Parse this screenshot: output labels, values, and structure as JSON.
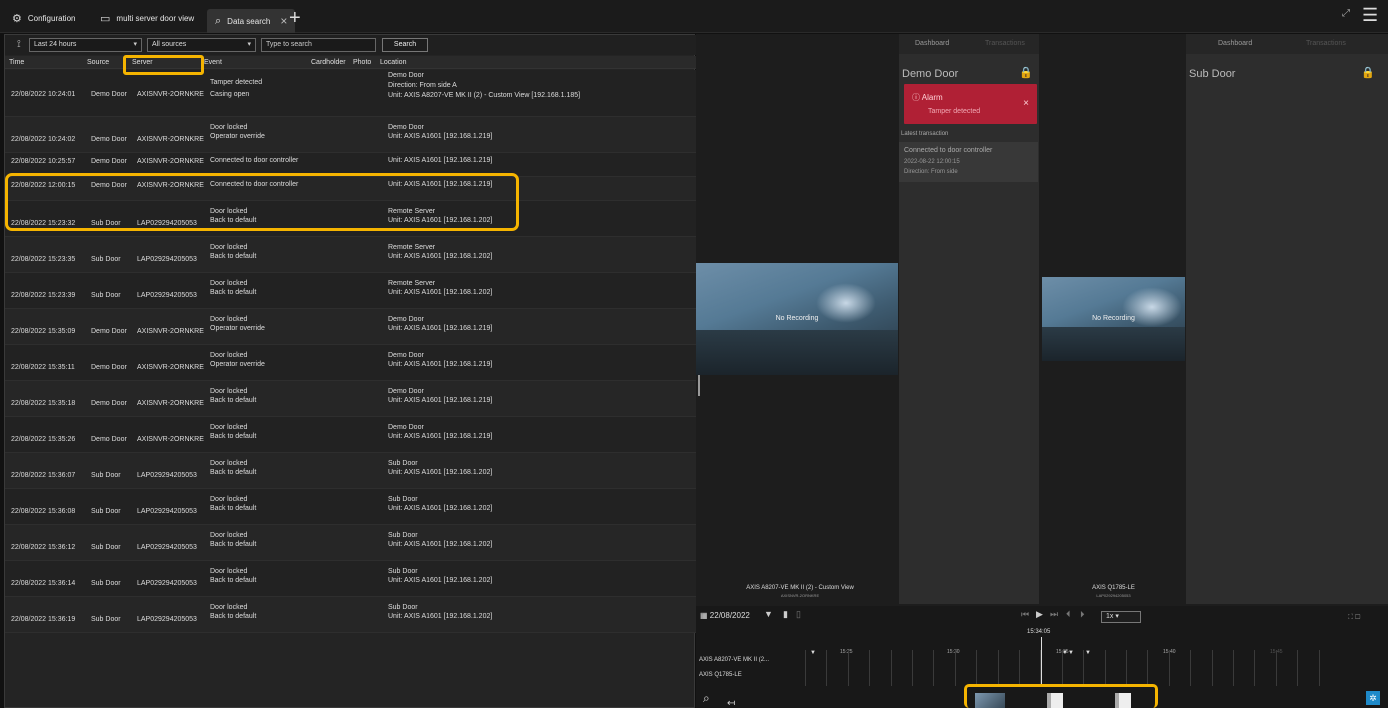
{
  "tabs": [
    {
      "label": "Configuration",
      "icon": "gear-icon"
    },
    {
      "label": "multi server door view",
      "icon": "monitor-icon"
    },
    {
      "label": "Data search",
      "icon": "search-icon"
    }
  ],
  "filters": {
    "time_range": "Last 24 hours",
    "sources": "All sources",
    "search_placeholder": "Type to search",
    "search_button": "Search"
  },
  "columns": [
    "Time",
    "Source",
    "Server",
    "Event",
    "Cardholder",
    "Photo",
    "Location"
  ],
  "rows": [
    {
      "time": "22/08/2022 10:24:01",
      "source": "Demo Door",
      "server": "AXISNVR-2ORNKRE",
      "event1": "Tamper detected",
      "event2": "Casing open",
      "loc1": "Demo Door",
      "loc2": "Direction: From side A",
      "loc3": "Unit: AXIS A8207-VE MK II (2) - Custom View [192.168.1.185]"
    },
    {
      "time": "22/08/2022 10:24:02",
      "source": "Demo Door",
      "server": "AXISNVR-2ORNKRE",
      "event1": "Door locked",
      "event2": "Operator override",
      "loc1": "Demo Door",
      "loc2": "Unit: AXIS A1601 [192.168.1.219]"
    },
    {
      "time": "22/08/2022 10:25:57",
      "source": "Demo Door",
      "server": "AXISNVR-2ORNKRE",
      "event1": "Connected to door controller",
      "event2": "",
      "loc1": "Unit: AXIS A1601 [192.168.1.219]",
      "loc2": ""
    },
    {
      "time": "22/08/2022 12:00:15",
      "source": "Demo Door",
      "server": "AXISNVR-2ORNKRE",
      "event1": "Connected to door controller",
      "event2": "",
      "loc1": "Unit: AXIS A1601 [192.168.1.219]",
      "loc2": ""
    },
    {
      "time": "22/08/2022 15:23:32",
      "source": "Sub Door",
      "server": "LAP029294205053",
      "event1": "Door locked",
      "event2": "Back to default",
      "loc1": "Remote Server",
      "loc2": "Unit: AXIS A1601 [192.168.1.202]"
    },
    {
      "time": "22/08/2022 15:23:35",
      "source": "Sub Door",
      "server": "LAP029294205053",
      "event1": "Door locked",
      "event2": "Back to default",
      "loc1": "Remote Server",
      "loc2": "Unit: AXIS A1601 [192.168.1.202]"
    },
    {
      "time": "22/08/2022 15:23:39",
      "source": "Sub Door",
      "server": "LAP029294205053",
      "event1": "Door locked",
      "event2": "Back to default",
      "loc1": "Remote Server",
      "loc2": "Unit: AXIS A1601 [192.168.1.202]"
    },
    {
      "time": "22/08/2022 15:35:09",
      "source": "Demo Door",
      "server": "AXISNVR-2ORNKRE",
      "event1": "Door locked",
      "event2": "Operator override",
      "loc1": "Demo Door",
      "loc2": "Unit: AXIS A1601 [192.168.1.219]"
    },
    {
      "time": "22/08/2022 15:35:11",
      "source": "Demo Door",
      "server": "AXISNVR-2ORNKRE",
      "event1": "Door locked",
      "event2": "Operator override",
      "loc1": "Demo Door",
      "loc2": "Unit: AXIS A1601 [192.168.1.219]"
    },
    {
      "time": "22/08/2022 15:35:18",
      "source": "Demo Door",
      "server": "AXISNVR-2ORNKRE",
      "event1": "Door locked",
      "event2": "Back to default",
      "loc1": "Demo Door",
      "loc2": "Unit: AXIS A1601 [192.168.1.219]"
    },
    {
      "time": "22/08/2022 15:35:26",
      "source": "Demo Door",
      "server": "AXISNVR-2ORNKRE",
      "event1": "Door locked",
      "event2": "Back to default",
      "loc1": "Demo Door",
      "loc2": "Unit: AXIS A1601 [192.168.1.219]"
    },
    {
      "time": "22/08/2022 15:36:07",
      "source": "Sub Door",
      "server": "LAP029294205053",
      "event1": "Door locked",
      "event2": "Back to default",
      "loc1": "Sub Door",
      "loc2": "Unit: AXIS A1601 [192.168.1.202]"
    },
    {
      "time": "22/08/2022 15:36:08",
      "source": "Sub Door",
      "server": "LAP029294205053",
      "event1": "Door locked",
      "event2": "Back to default",
      "loc1": "Sub Door",
      "loc2": "Unit: AXIS A1601 [192.168.1.202]"
    },
    {
      "time": "22/08/2022 15:36:12",
      "source": "Sub Door",
      "server": "LAP029294205053",
      "event1": "Door locked",
      "event2": "Back to default",
      "loc1": "Sub Door",
      "loc2": "Unit: AXIS A1601 [192.168.1.202]"
    },
    {
      "time": "22/08/2022 15:36:14",
      "source": "Sub Door",
      "server": "LAP029294205053",
      "event1": "Door locked",
      "event2": "Back to default",
      "loc1": "Sub Door",
      "loc2": "Unit: AXIS A1601 [192.168.1.202]"
    },
    {
      "time": "22/08/2022 15:36:19",
      "source": "Sub Door",
      "server": "LAP029294205053",
      "event1": "Door locked",
      "event2": "Back to default",
      "loc1": "Sub Door",
      "loc2": "Unit: AXIS A1601 [192.168.1.202]"
    }
  ],
  "doors": {
    "demo": {
      "tab_dashboard": "Dashboard",
      "tab_transactions": "Transactions",
      "title": "Demo Door",
      "alarm_title": "Alarm",
      "alarm_detail": "Tamper detected",
      "latest_label": "Latest transaction",
      "trans_event": "Connected to door controller",
      "trans_time": "2022-08-22 12:00:15",
      "trans_direction": "Direction: From side"
    },
    "sub": {
      "tab_dashboard": "Dashboard",
      "tab_transactions": "Transactions",
      "title": "Sub Door"
    }
  },
  "cameras": {
    "cam1": {
      "no_recording": "No Recording",
      "name": "AXIS A8207-VE MK II (2) - Custom View",
      "server": "AXISNVR-2ORNKRE"
    },
    "cam2": {
      "no_recording": "No Recording",
      "name": "AXIS Q1785-LE",
      "server": "LAP029294205053"
    }
  },
  "timeline": {
    "date": "22/08/2022",
    "speed": "1x",
    "current_time": "15:34:05",
    "ticks": [
      "15:25",
      "15:30",
      "15:35",
      "15:40",
      "15:45"
    ],
    "track1": "AXIS A8207-VE MK II (2...",
    "track2": "AXIS Q1785-LE"
  },
  "colors": {
    "highlight": "#f5b400",
    "alarm": "#b02035",
    "accent": "#1f8ac9"
  }
}
